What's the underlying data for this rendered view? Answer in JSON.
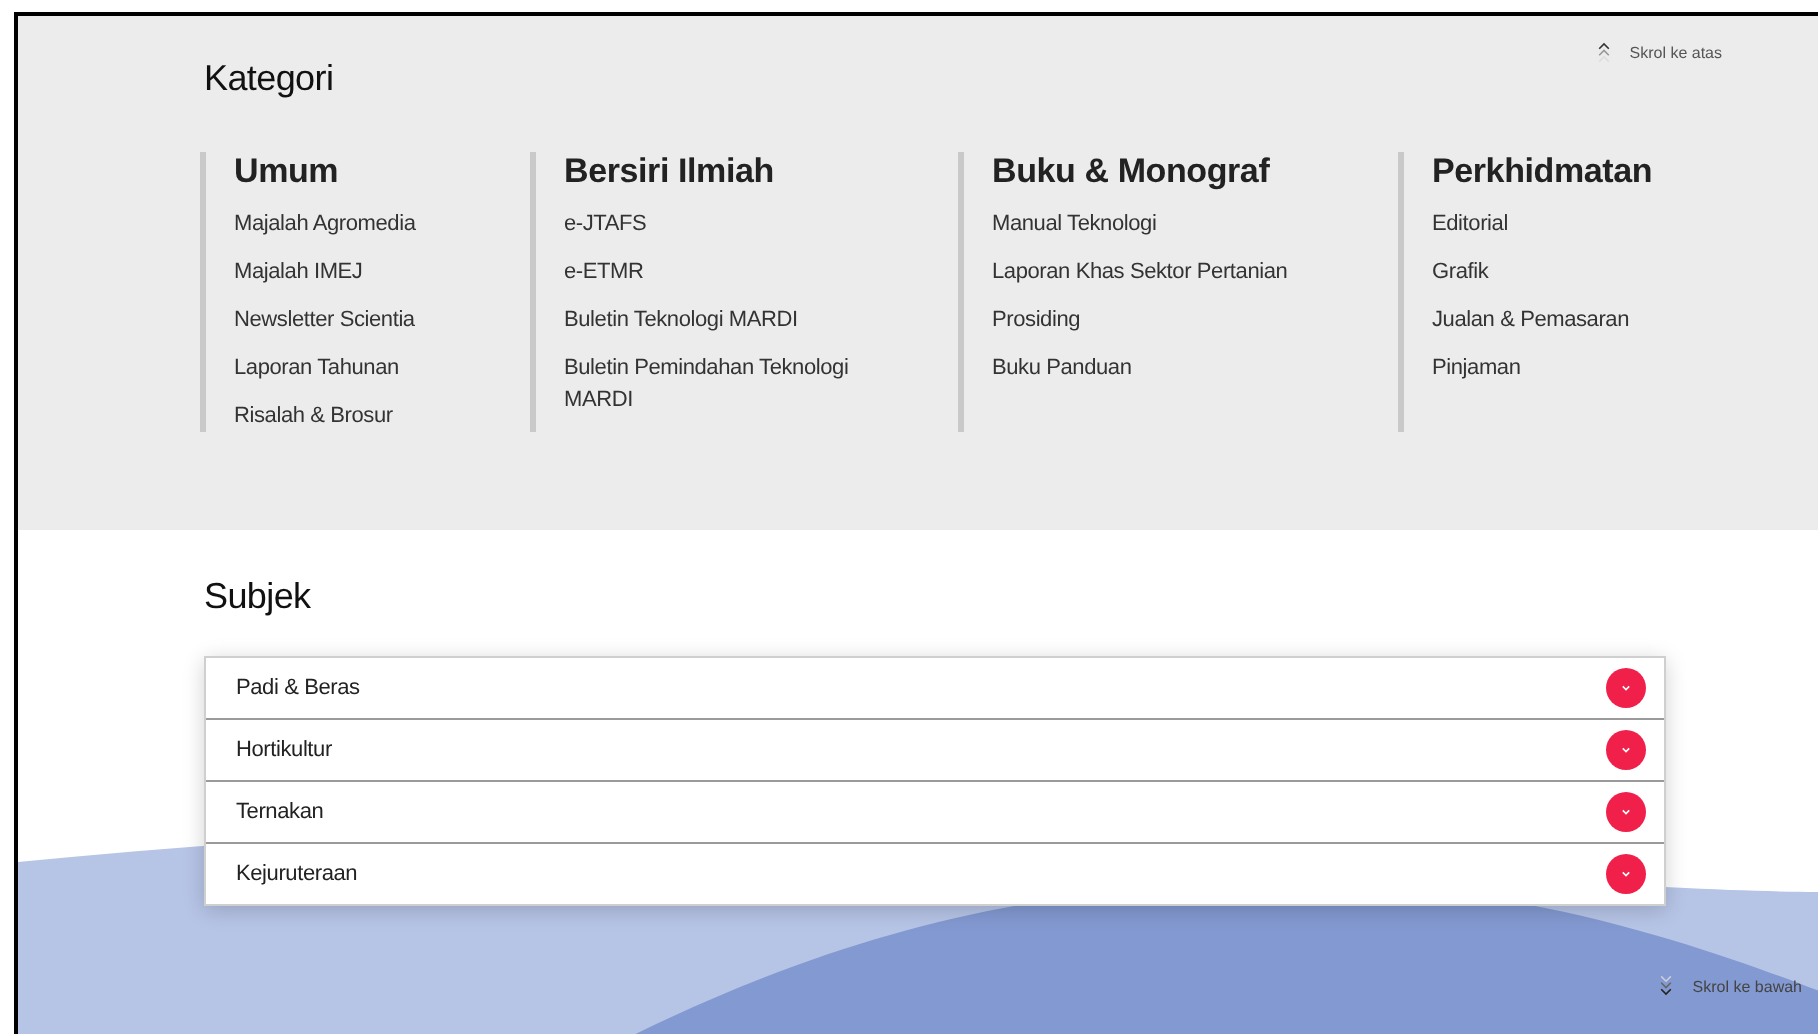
{
  "scroll_top": {
    "label": "Skrol ke atas"
  },
  "kategori": {
    "title": "Kategori",
    "columns": [
      {
        "heading": "Umum",
        "items": [
          "Majalah Agromedia",
          "Majalah IMEJ",
          "Newsletter Scientia",
          "Laporan Tahunan",
          "Risalah & Brosur"
        ]
      },
      {
        "heading": "Bersiri Ilmiah",
        "items": [
          "e-JTAFS",
          "e-ETMR",
          "Buletin Teknologi MARDI",
          "Buletin Pemindahan Teknologi MARDI"
        ]
      },
      {
        "heading": "Buku & Monograf",
        "items": [
          "Manual Teknologi",
          "Laporan Khas Sektor Pertanian",
          "Prosiding",
          "Buku Panduan"
        ]
      },
      {
        "heading": "Perkhidmatan",
        "items": [
          "Editorial",
          "Grafik",
          "Jualan & Pemasaran",
          "Pinjaman"
        ]
      }
    ]
  },
  "subjek": {
    "title": "Subjek",
    "items": [
      {
        "label": "Padi & Beras",
        "expanded": false
      },
      {
        "label": "Hortikultur",
        "expanded": false
      },
      {
        "label": "Ternakan",
        "expanded": false
      },
      {
        "label": "Kejuruteraan",
        "expanded": false
      }
    ]
  },
  "scroll_bottom": {
    "label": "Skrol ke bawah"
  }
}
